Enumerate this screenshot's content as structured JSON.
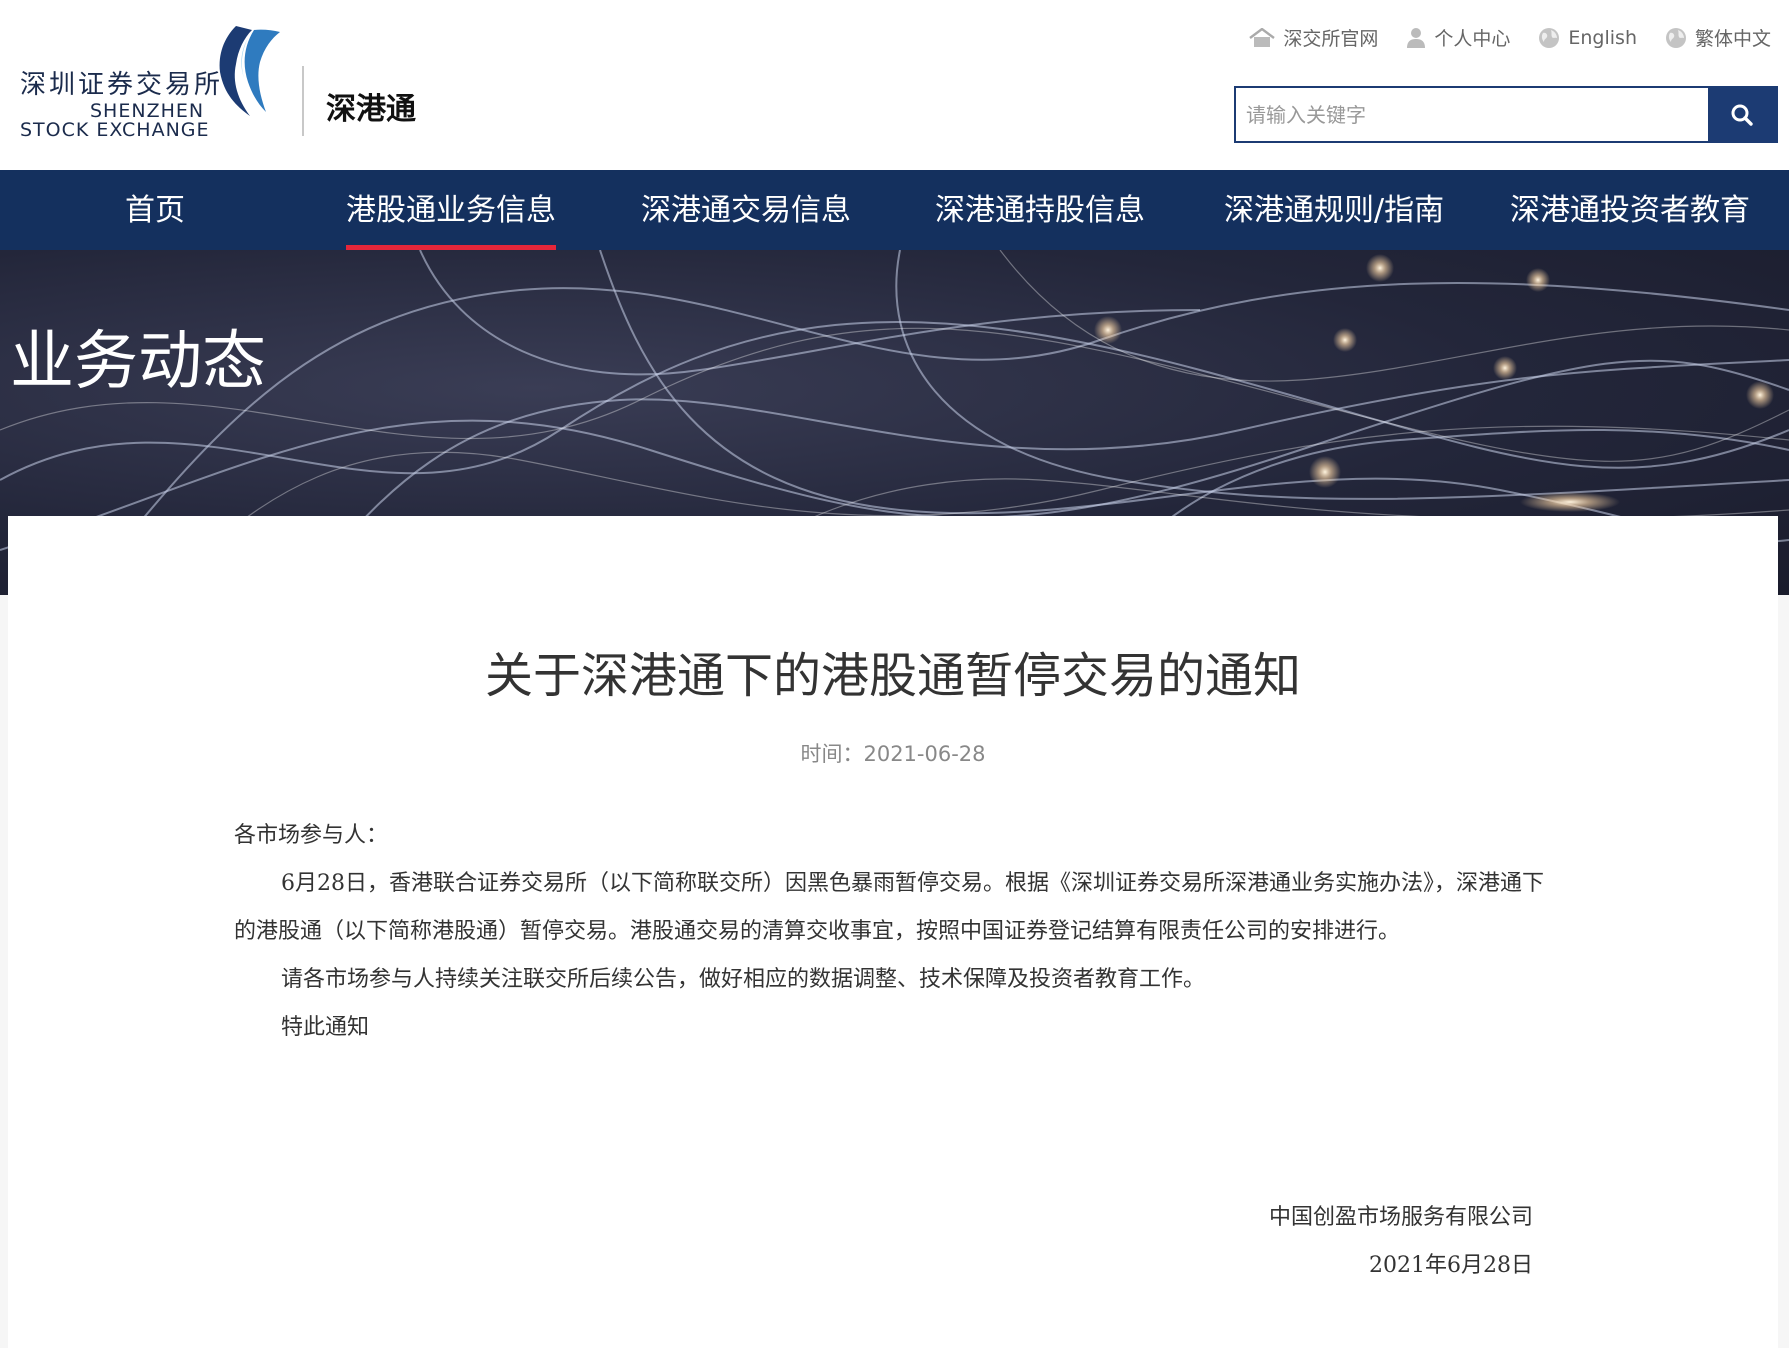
{
  "header": {
    "logo_cn": "深圳证券交易所",
    "logo_en_line1": "SHENZHEN",
    "logo_en_line2": "STOCK EXCHANGE",
    "brand": "深港通",
    "toplinks": [
      {
        "label": "深交所官网",
        "icon": "home-icon"
      },
      {
        "label": "个人中心",
        "icon": "user-icon"
      },
      {
        "label": "English",
        "icon": "globe-icon"
      },
      {
        "label": "繁体中文",
        "icon": "globe-icon"
      }
    ],
    "search": {
      "placeholder": "请输入关键字",
      "value": ""
    }
  },
  "nav": {
    "items": [
      {
        "label": "首页",
        "active": false
      },
      {
        "label": "港股通业务信息",
        "active": true
      },
      {
        "label": "深港通交易信息",
        "active": false
      },
      {
        "label": "深港通持股信息",
        "active": false
      },
      {
        "label": "深港通规则/指南",
        "active": false
      },
      {
        "label": "深港通投资者教育",
        "active": false
      }
    ],
    "active_underline_color": "#e5263a",
    "background_color": "#14305e"
  },
  "banner": {
    "title": "业务动态"
  },
  "article": {
    "title": "关于深港通下的港股通暂停交易的通知",
    "time_label": "时间：",
    "time_value": "2021-06-28",
    "salutation": "各市场参与人：",
    "paragraph1": "6月28日，香港联合证券交易所（以下简称联交所）因黑色暴雨暂停交易。根据《深圳证券交易所深港通业务实施办法》，深港通下的港股通（以下简称港股通）暂停交易。港股通交易的清算交收事宜，按照中国证券登记结算有限责任公司的安排进行。",
    "paragraph2": "请各市场参与人持续关注联交所后续公告，做好相应的数据调整、技术保障及投资者教育工作。",
    "closing": "特此通知",
    "signer": "中国创盈市场服务有限公司",
    "sign_date": "2021年6月28日"
  }
}
